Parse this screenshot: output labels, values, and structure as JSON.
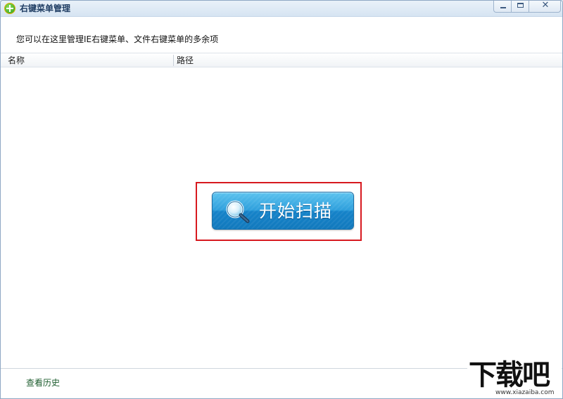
{
  "window": {
    "title": "右键菜单管理"
  },
  "header": {
    "description": "您可以在这里管理IE右键菜单、文件右键菜单的多余项"
  },
  "table": {
    "columns": [
      "名称",
      "路径"
    ],
    "rows": []
  },
  "scan": {
    "label": "开始扫描",
    "icon": "magnifier-icon",
    "color": "#2e9fdc"
  },
  "footer": {
    "history_link": "查看历史"
  },
  "watermark": {
    "brand": "下载吧",
    "url": "www.xiazaiba.com"
  }
}
